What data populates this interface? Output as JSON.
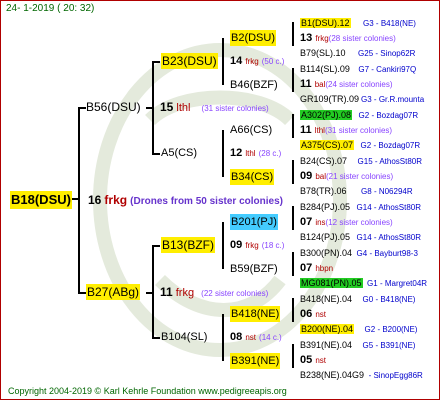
{
  "date": "24-  1-2019 (  20: 32)",
  "footer": "Copyright 2004-2019 © Karl Kehrle Foundation   www.pedigreeapis.org",
  "root": {
    "id": "B18(DSU)",
    "num": "16",
    "word": "frkg",
    "note": "(Drones from 50 sister colonies)"
  },
  "g1": {
    "top": {
      "id": "B56(DSU)",
      "num": "15",
      "word": "lthl",
      "note": "(31 sister colonies)"
    },
    "bot": {
      "id": "B27(ABg)",
      "num": "11",
      "word": "frkg",
      "note": "(22 sister colonies)"
    }
  },
  "g2": {
    "a": {
      "id": "B23(DSU)",
      "num": "14",
      "word": "frkg",
      "note": "(50 c.)"
    },
    "b": {
      "id": "A5(CS)",
      "num": "12",
      "word": "lthl",
      "note": "(28 c.)"
    },
    "c": {
      "id": "B13(BZF)",
      "num": "09",
      "word": "frkg",
      "note": "(18 c.)"
    },
    "d": {
      "id": "B104(SL)",
      "num": "08",
      "word": "nst",
      "note": "(14 c.)"
    }
  },
  "g3": [
    {
      "id": "B2(DSU)",
      "num": "13",
      "word": "frkg",
      "note": "(28 sister colonies)"
    },
    {
      "id": "B46(BZF)",
      "num": "11",
      "word": "bal",
      "note": "(24 sister colonies)"
    },
    {
      "id": "A66(CS)",
      "num": "11",
      "word": "lthl",
      "note": "(31 sister colonies)"
    },
    {
      "id": "B34(CS)",
      "num": "09",
      "word": "bal",
      "note": "(21 sister colonies)"
    },
    {
      "id": "B201(PJ)",
      "num": "07",
      "word": "ins",
      "note": "(12 sister colonies)"
    },
    {
      "id": "B59(BZF)",
      "num": "07",
      "word": "hbpn",
      "note": ""
    },
    {
      "id": "B418(NE)",
      "num": "06",
      "word": "nst",
      "note": ""
    },
    {
      "id": "B391(NE)",
      "num": "05",
      "word": "nst",
      "note": ""
    }
  ],
  "g4": [
    {
      "id": "B1(DSU).12",
      "ref": "G3 - B418(NE)"
    },
    {
      "id": "B79(SL).10",
      "ref": "G25 - Sinop62R"
    },
    {
      "id": "B114(SL).09",
      "ref": "G7 - Cankiri97Q"
    },
    {
      "id": "GR109(TR).09",
      "ref": "G3 - Gr.R.mounta"
    },
    {
      "id": "A302(PJ).08",
      "ref": "G2 - Bozdag07R"
    },
    {
      "id": "A375(CS).07",
      "ref": "G2 - Bozdag07R"
    },
    {
      "id": "B24(CS).07",
      "ref": "G15 - AthosSt80R"
    },
    {
      "id": "B78(TR).06",
      "ref": "G8 - N06294R"
    },
    {
      "id": "B284(PJ).05",
      "ref": "G14 - AthosSt80R"
    },
    {
      "id": "B124(PJ).05",
      "ref": "G14 - AthosSt80R"
    },
    {
      "id": "B300(PN).04",
      "ref": "G4 - Bayburt98-3"
    },
    {
      "id": "MG081(PN).05",
      "ref": "G1 - Margret04R"
    },
    {
      "id": "B418(NE).04",
      "ref": "G0 - B418(NE)"
    },
    {
      "id": "B200(NE).04",
      "ref": "G2 - B200(NE)"
    },
    {
      "id": "B391(NE).04",
      "ref": "G5 - B391(NE)"
    },
    {
      "id": "B238(NE).04G9",
      "ref": "- SinopEgg86R"
    }
  ],
  "colors": {
    "yellow": "#ffee00",
    "green": "#22cc22",
    "cyan": "#44ccff",
    "purple": "#8844ff",
    "red": "#b00000",
    "blue": "#0000cc"
  }
}
